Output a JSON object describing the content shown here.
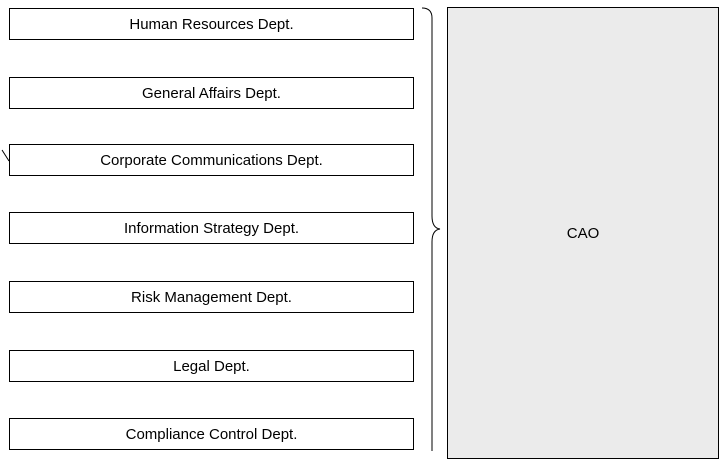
{
  "departments": [
    "Human Resources Dept.",
    "General Affairs Dept.",
    "Corporate Communications Dept.",
    "Information Strategy Dept.",
    "Risk Management Dept.",
    "Legal Dept.",
    "Compliance Control Dept."
  ],
  "executive": {
    "label": "CAO"
  },
  "colors": {
    "executive_fill": "#ebebeb",
    "box_border": "#000000",
    "box_fill": "#ffffff"
  }
}
